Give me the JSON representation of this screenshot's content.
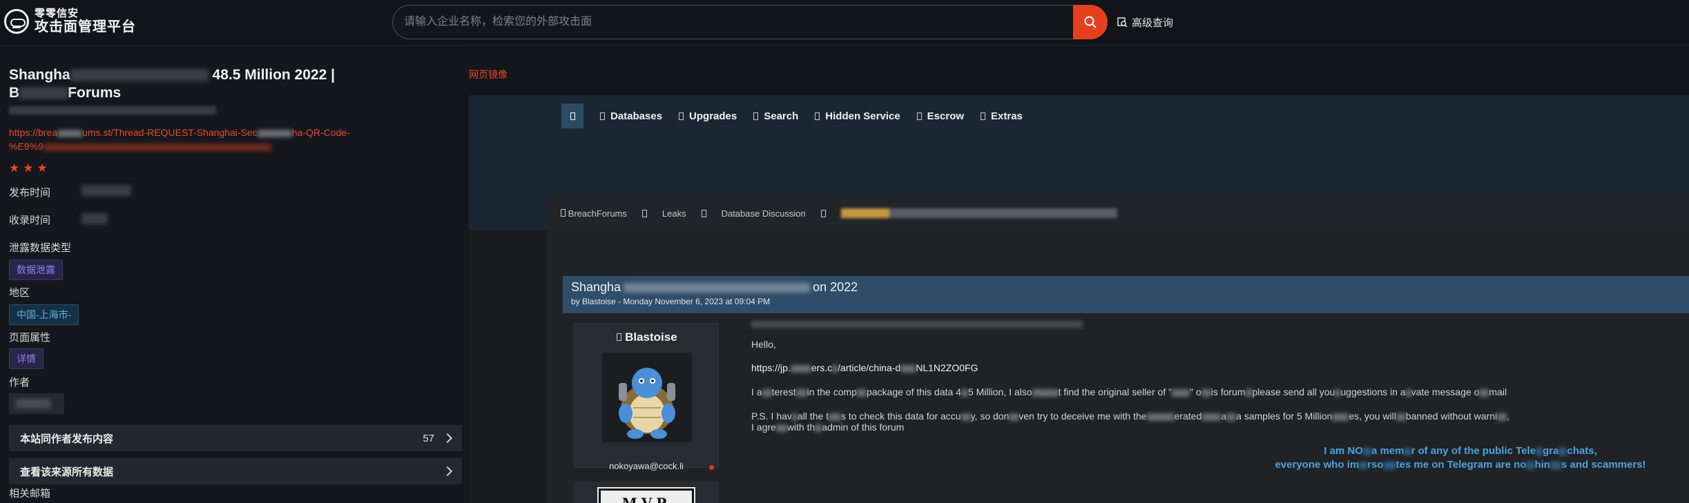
{
  "brand": {
    "sub": "零零信安",
    "main": "攻击面管理平台"
  },
  "search": {
    "placeholder": "请输入企业名称，检索您的外部攻击面",
    "advanced_label": "高级查询"
  },
  "detail": {
    "title_start": "Shangha",
    "title_end": "48.5 Million 2022 |",
    "title_line2": "B",
    "title_line2_end": "Forums",
    "url": "https://brea",
    "url_mid": "ums.st/Thread-REQUEST-Shanghai-Sec",
    "url_end": "ha-QR-Code-",
    "url_line2": "%E9%9",
    "rating_stars": 3,
    "publish_time_label": "发布时间",
    "collect_time_label": "收录时间",
    "leak_type_label": "泄露数据类型",
    "leak_type_value": "数据泄露",
    "region_label": "地区",
    "region_value": "中国-上海市-",
    "page_attr_label": "页面属性",
    "page_attr_value": "详情",
    "author_label": "作者",
    "same_author_label": "本站同作者发布内容",
    "same_author_count": "57",
    "view_source_label": "查看该来源所有数据",
    "related_email_label": "相关邮箱"
  },
  "mirror": {
    "label": "网页镜像",
    "nav": [
      "Databases",
      "Upgrades",
      "Search",
      "Hidden Service",
      "Escrow",
      "Extras"
    ],
    "breadcrumb": [
      "BreachForums",
      "Leaks",
      "Database Discussion"
    ],
    "thread_title_start": "Shangha",
    "thread_title_end": "on 2022",
    "thread_by": "by Blastoise - Monday November 6, 2023 at 09:04 PM",
    "username": "Blastoise",
    "user_email": "nokoyawa@cock.li",
    "mvp": "MVP",
    "post": {
      "hello": "Hello,",
      "link_a": "https://jp.",
      "link_b": "ers.c",
      "link_c": "/article/china-d",
      "link_d": "NL1N2ZO0FG",
      "p1_a": "I a",
      "p1_b": "terest",
      "p1_c": "in the comp",
      "p1_d": "package of this data 4",
      "p1_e": "5 Million, I also",
      "p1_f": "t find the original seller of \"",
      "p1_g": "\" o",
      "p1_h": "is forum",
      "p1_i": "please send all you",
      "p1_j": "uggestions in a",
      "p1_k": "vate message o",
      "p1_l": "mail",
      "p2_a": "P.S. I hav",
      "p2_b": "all the t",
      "p2_c": "s to check this data for accu",
      "p2_d": "y, so don",
      "p2_e": "ven try to deceive me with the",
      "p2_f": "erated",
      "p2_g": "a",
      "p2_h": "a samples for 5 Million",
      "p2_i": "es, you will",
      "p2_j": "banned without warni",
      "p2_k": ",",
      "p3_a": "I agre",
      "p3_b": "with th",
      "p3_c": "admin of this forum"
    },
    "notice_line1_a": "I am NO",
    "notice_line1_b": "a mem",
    "notice_line1_c": "r of any of the public Tele",
    "notice_line1_d": "gra",
    "notice_line1_e": "chats,",
    "notice_line2_a": "everyone who im",
    "notice_line2_b": "rso",
    "notice_line2_c": "tes me on Telegram are no",
    "notice_line2_d": "hin",
    "notice_line2_e": "s and scammers!"
  },
  "colors": {
    "accent": "#e4401f",
    "purple_tag": "#8f7ef0",
    "blue_tag": "#5fb3e4",
    "thread_header": "#2e4d69",
    "notice": "#4aa3e0"
  }
}
